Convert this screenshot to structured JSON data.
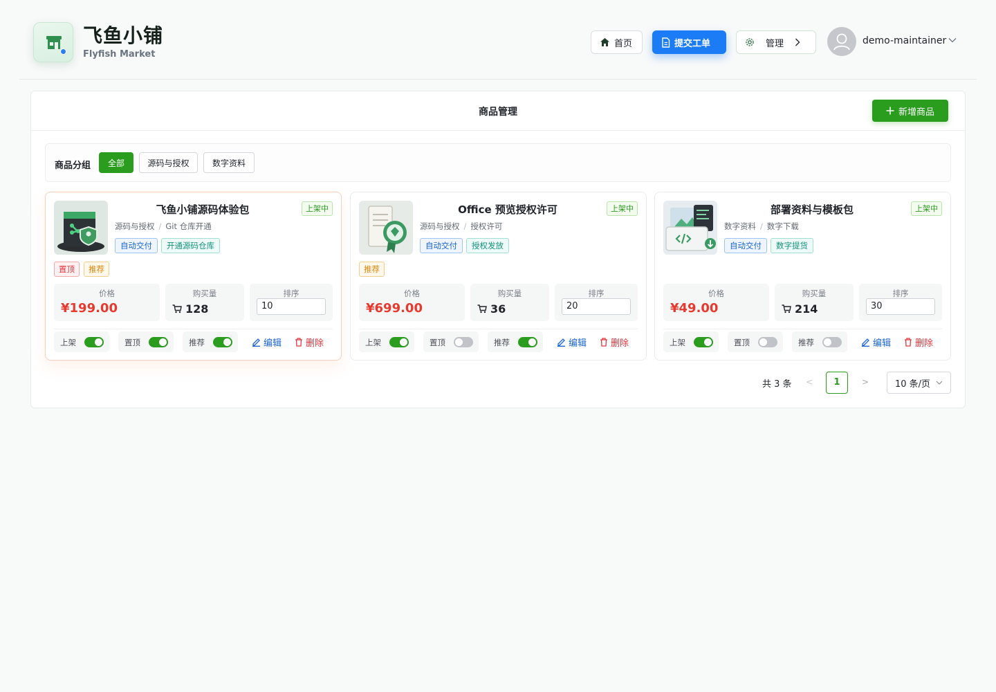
{
  "brand": {
    "title": "飞鱼小铺",
    "subtitle": "Flyfish Market",
    "logo_icon": "storefront-icon"
  },
  "nav": {
    "home": {
      "label": "首页",
      "icon": "home-icon"
    },
    "submit": {
      "label": "提交工单",
      "icon": "document-icon"
    },
    "manage": {
      "label": "管理",
      "icon": "gear-icon"
    },
    "user": {
      "name": "demo-maintainer",
      "icon": "user-avatar-icon"
    }
  },
  "panel": {
    "title": "商品管理",
    "add_button": "新增商品",
    "filter": {
      "label": "商品分组",
      "options": [
        "全部",
        "源码与授权",
        "数字资料"
      ],
      "selected": "全部"
    }
  },
  "labels": {
    "price": "价格",
    "purchases": "购买量",
    "sort": "排序",
    "listed": "上架",
    "pinned": "置顶",
    "recommended": "推荐",
    "edit": "编辑",
    "delete": "删除"
  },
  "products": [
    {
      "title": "飞鱼小铺源码体验包",
      "status": "上架中",
      "category": "源码与授权",
      "subcategory": "Git 仓库开通",
      "tags": [
        "自动交付",
        "开通源码仓库"
      ],
      "flags": [
        "置顶",
        "推荐"
      ],
      "price": "¥199.00",
      "purchases": "128",
      "sort": "10",
      "listed": true,
      "pinned": true,
      "recommended": true
    },
    {
      "title": "Office 预览授权许可",
      "status": "上架中",
      "category": "源码与授权",
      "subcategory": "授权许可",
      "tags": [
        "自动交付",
        "授权发放"
      ],
      "flags": [
        "推荐"
      ],
      "price": "¥699.00",
      "purchases": "36",
      "sort": "20",
      "listed": true,
      "pinned": false,
      "recommended": true
    },
    {
      "title": "部署资料与模板包",
      "status": "上架中",
      "category": "数字资料",
      "subcategory": "数字下载",
      "tags": [
        "自动交付",
        "数字提货"
      ],
      "flags": [],
      "price": "¥49.00",
      "purchases": "214",
      "sort": "30",
      "listed": true,
      "pinned": false,
      "recommended": false
    }
  ],
  "pagination": {
    "total": "共 3 条",
    "current": "1",
    "page_size": "10 条/页"
  },
  "colors": {
    "primary_green": "#2a9d1f",
    "primary_blue": "#1b7cf5",
    "price_red": "#e8392f"
  }
}
